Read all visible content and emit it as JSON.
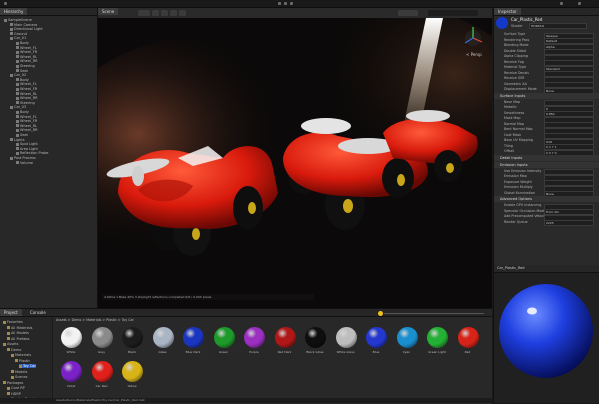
{
  "colors": {
    "accent": "#2d5fbf",
    "car_red": "#e02010",
    "panel": "#282828"
  },
  "hierarchy": {
    "tab": "Hierarchy",
    "items": [
      "SampleScene",
      "Main Camera",
      "Directional Light",
      "Ground",
      "Car_01",
      "Body",
      "Wheel_FL",
      "Wheel_FR",
      "Wheel_RL",
      "Wheel_RR",
      "Steering",
      "Seat",
      "Car_02",
      "Body",
      "Wheel_FL",
      "Wheel_FR",
      "Wheel_RL",
      "Wheel_RR",
      "Steering",
      "Car_03",
      "Body",
      "Wheel_FL",
      "Wheel_FR",
      "Wheel_RL",
      "Wheel_RR",
      "Seat",
      "Lights",
      "Spot Light",
      "Area Light",
      "Reflection Probe",
      "Post Process",
      "Volume"
    ]
  },
  "scene": {
    "tab": "Scene",
    "shading": "Shaded",
    "mode_2d": "2D",
    "gizmos": "Gizmos",
    "search_placeholder": "All",
    "status_text": "4.00ms 1 Bake 40% 3 stoplight reflections completed 6/6 / 0.000 pixels",
    "view_label": "< Persp"
  },
  "inspector": {
    "tab": "Inspector",
    "title": "Car_Plastic_Red",
    "shader_label": "Shader",
    "shader_value": "HDRP/Lit",
    "rows": [
      {
        "label": "Surface Type",
        "value": "Opaque"
      },
      {
        "label": "Rendering Pass",
        "value": "Default"
      },
      {
        "label": "Blending Mode",
        "value": "Alpha"
      },
      {
        "label": "Double Sided",
        "value": ""
      },
      {
        "label": "Alpha Clipping",
        "value": ""
      },
      {
        "label": "Receive Fog",
        "value": ""
      },
      {
        "label": "Material Type",
        "value": "Standard"
      },
      {
        "label": "Receive Decals",
        "value": ""
      },
      {
        "label": "Receive SSR",
        "value": ""
      },
      {
        "label": "Geometric AA",
        "value": ""
      },
      {
        "label": "Displacement Mode",
        "value": "None"
      }
    ],
    "surface_inputs": "Surface Inputs",
    "rows2": [
      {
        "label": "Base Map",
        "value": ""
      },
      {
        "label": "Metallic",
        "value": "0"
      },
      {
        "label": "Smoothness",
        "value": "0.850"
      },
      {
        "label": "Mask Map",
        "value": ""
      },
      {
        "label": "Normal Map",
        "value": ""
      },
      {
        "label": "Bent Normal Map",
        "value": ""
      },
      {
        "label": "Coat Mask",
        "value": ""
      },
      {
        "label": "Base UV Mapping",
        "value": "UV0"
      },
      {
        "label": "Tiling",
        "value": "X 1  Y 1"
      },
      {
        "label": "Offset",
        "value": "X 0  Y 0"
      }
    ],
    "detail_inputs": "Detail Inputs",
    "emission_inputs": "Emission Inputs",
    "rows3": [
      {
        "label": "Use Emission Intensity",
        "value": ""
      },
      {
        "label": "Emission Map",
        "value": ""
      },
      {
        "label": "Exposure Weight",
        "value": ""
      },
      {
        "label": "Emission Multiply",
        "value": ""
      },
      {
        "label": "Global Illumination",
        "value": "None"
      }
    ],
    "advanced": "Advanced Options",
    "rows4": [
      {
        "label": "Enable GPU Instancing",
        "value": ""
      },
      {
        "label": "Specular Occlusion Mode",
        "value": "From AO"
      },
      {
        "label": "Add Precomputed Velocity",
        "value": ""
      }
    ],
    "render_queue": "Render Queue",
    "render_queue_value": "2225"
  },
  "project": {
    "tabs": [
      "Project",
      "Console"
    ],
    "breadcrumb": "Assets > Demo > Materials > Plastic > Toy Car",
    "tree": [
      "Favorites",
      "All Materials",
      "All Models",
      "All Prefabs",
      "Assets",
      "Demo",
      "Materials",
      "Plastic",
      "Toy Car",
      "Models",
      "Scenes",
      "Packages",
      "Core RP",
      "HDRP",
      "Shader Graph"
    ],
    "materials": [
      {
        "name": "White",
        "color": "#f2f2f2"
      },
      {
        "name": "Grey",
        "color": "#8a8a8a"
      },
      {
        "name": "Black",
        "color": "#1c1c1c"
      },
      {
        "name": "Glass",
        "color": "#a9b4c4"
      },
      {
        "name": "Blue Dark",
        "color": "#1a36c0"
      },
      {
        "name": "Green",
        "color": "#1e9a2a"
      },
      {
        "name": "Purple",
        "color": "#9a2fc0"
      },
      {
        "name": "Red Dark",
        "color": "#b01818"
      },
      {
        "name": "Black Gloss",
        "color": "#0e0e0e"
      },
      {
        "name": "White Gloss",
        "color": "#bdbdbd"
      },
      {
        "name": "Blue",
        "color": "#2438d0"
      },
      {
        "name": "Cyan",
        "color": "#1a8fd0"
      },
      {
        "name": "Green Light",
        "color": "#24b034"
      },
      {
        "name": "Red",
        "color": "#d82418"
      },
      {
        "name": "Violet",
        "color": "#7a22c8"
      },
      {
        "name": "Car Red",
        "color": "#e0201a"
      },
      {
        "name": "Yellow",
        "color": "#d8b418"
      }
    ],
    "status": "Assets/Demo/Materials/Plastic/Toy Car/Car_Plastic_Red.mat"
  },
  "preview": {
    "label": "Car_Plastic_Red"
  }
}
